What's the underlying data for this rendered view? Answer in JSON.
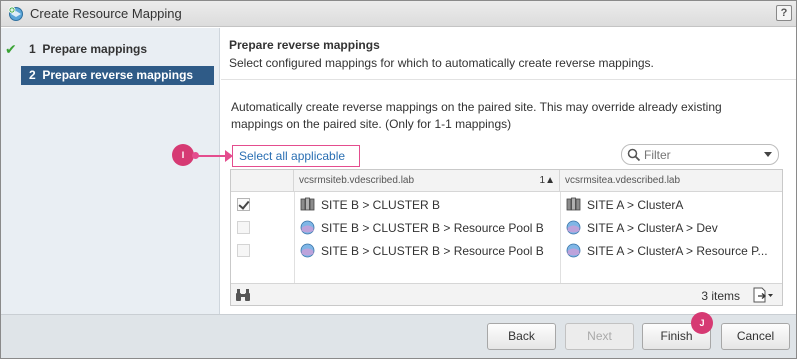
{
  "window": {
    "title": "Create Resource Mapping",
    "help": "?"
  },
  "sidebar": {
    "steps": [
      {
        "number": "1",
        "label": "Prepare mappings",
        "state": "completed"
      },
      {
        "number": "2",
        "label": "Prepare reverse mappings",
        "state": "active"
      }
    ]
  },
  "page": {
    "title": "Prepare reverse mappings",
    "subtitle": "Select configured mappings for which to automatically create reverse mappings.",
    "description": "Automatically create reverse mappings on the paired site. This may override already existing mappings on the paired site. (Only for 1-1 mappings)",
    "select_all_link": "Select all applicable"
  },
  "filter": {
    "placeholder": "Filter"
  },
  "grid": {
    "columns": [
      {
        "label": "vcsrmsiteb.vdescribed.lab",
        "sort": "1▲"
      },
      {
        "label": "vcsrmsitea.vdescribed.lab"
      }
    ],
    "rows": [
      {
        "checked": true,
        "enabled": true,
        "source": "SITE B > CLUSTER B",
        "source_icon": "cluster-icon",
        "target": "SITE A > ClusterA",
        "target_icon": "cluster-icon"
      },
      {
        "checked": false,
        "enabled": false,
        "source": "SITE B > CLUSTER B > Resource Pool B",
        "source_icon": "resource-pool-icon",
        "target": "SITE A > ClusterA > Dev",
        "target_icon": "resource-pool-icon"
      },
      {
        "checked": false,
        "enabled": false,
        "source": "SITE B > CLUSTER B > Resource Pool B",
        "source_icon": "resource-pool-icon",
        "target": "SITE A > ClusterA > Resource P...",
        "target_icon": "resource-pool-icon"
      }
    ],
    "footer": {
      "count": "3 items"
    }
  },
  "callouts": {
    "i": "I",
    "j": "J"
  },
  "buttons": {
    "back": "Back",
    "next": "Next",
    "finish": "Finish",
    "cancel": "Cancel"
  },
  "colors": {
    "accent": "#2f5b87",
    "callout": "#d63a73",
    "link": "#2a6fb3",
    "check": "#3aa335"
  }
}
